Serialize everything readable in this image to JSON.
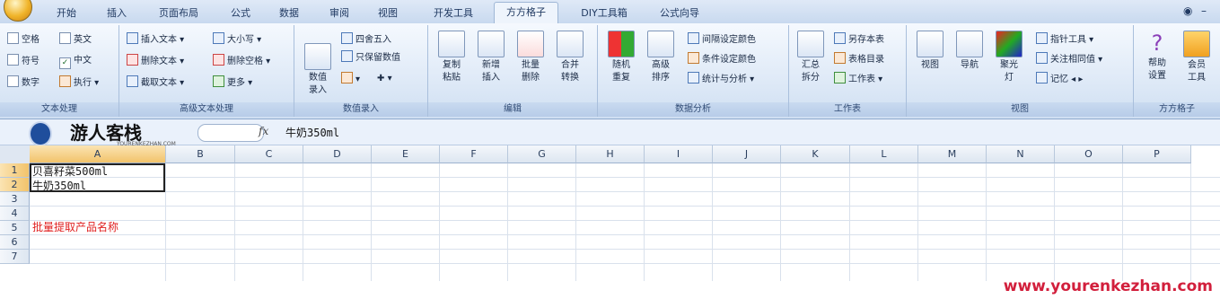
{
  "tabs": [
    "开始",
    "插入",
    "页面布局",
    "公式",
    "数据",
    "审阅",
    "视图",
    "开发工具",
    "方方格子",
    "DIY工具箱",
    "公式向导"
  ],
  "active_tab": "方方格子",
  "window_controls": [
    "◉",
    "–"
  ],
  "ribbon": {
    "text_processing": {
      "label": "文本处理",
      "items": [
        "空格",
        "英文",
        "符号",
        "中文",
        "数字",
        "执行"
      ]
    },
    "advanced_text": {
      "label": "高级文本处理",
      "items": [
        "插入文本",
        "大小写",
        "删除文本",
        "删除空格",
        "截取文本",
        "更多"
      ]
    },
    "numeric_entry": {
      "label": "数值录入",
      "big": "数值\n录入",
      "items": [
        "四舍五入",
        "只保留数值"
      ]
    },
    "edit": {
      "label": "编辑",
      "buttons": [
        "复制\n粘贴",
        "新增\n插入",
        "批量\n删除",
        "合并\n转换"
      ]
    },
    "data_analysis": {
      "label": "数据分析",
      "buttons": [
        "随机\n重复",
        "高级\n排序"
      ],
      "items": [
        "间隔设定颜色",
        "条件设定颜色",
        "统计与分析"
      ]
    },
    "worksheet": {
      "label": "工作表",
      "big": "汇总\n拆分",
      "items": [
        "另存本表",
        "表格目录",
        "工作表"
      ]
    },
    "view": {
      "label": "视图",
      "buttons": [
        "视图",
        "导航",
        "聚光\n灯"
      ],
      "items": [
        "指针工具",
        "关注相同值",
        "记忆"
      ]
    },
    "fangfang": {
      "label": "方方格子",
      "buttons": [
        "帮助\n设置",
        "会员\n工具"
      ]
    }
  },
  "formula_bar": {
    "logo_text": "游人客栈",
    "logo_sub": "YOURENKEZHAN.COM",
    "fx": "fx",
    "formula": "牛奶350ml"
  },
  "columns": [
    "A",
    "B",
    "C",
    "D",
    "E",
    "F",
    "G",
    "H",
    "I",
    "J",
    "K",
    "L",
    "M",
    "N",
    "O",
    "P"
  ],
  "rows": [
    "1",
    "2",
    "3",
    "4",
    "5",
    "6",
    "7"
  ],
  "cells": {
    "A1": "贝喜籽菜500ml",
    "A2": "牛奶350ml",
    "A4": "批量提取产品名称"
  },
  "colors": {
    "accent": "#f2c36b",
    "red_text": "#e02020",
    "watermark": "#d21f3c"
  },
  "watermark": "www.yourenkezhan.com"
}
